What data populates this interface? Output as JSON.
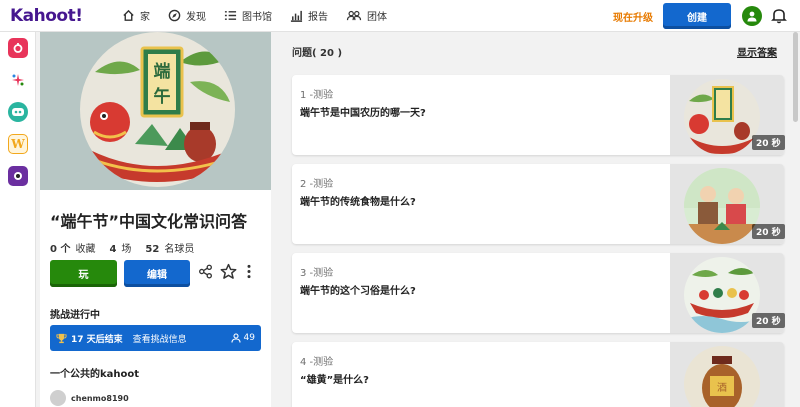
{
  "nav": {
    "logo": "Kahoot!",
    "items": [
      {
        "label": "家",
        "icon": "home-icon"
      },
      {
        "label": "发现",
        "icon": "compass-icon"
      },
      {
        "label": "图书馆",
        "icon": "list-icon"
      },
      {
        "label": "报告",
        "icon": "bar-chart-icon"
      },
      {
        "label": "团体",
        "icon": "group-icon"
      }
    ],
    "upgrade": "现在升级",
    "create": "创建"
  },
  "rail": {
    "apps": [
      {
        "name": "app-icon-1",
        "color": "#e8345a",
        "glyph": "o"
      },
      {
        "name": "app-icon-2",
        "color": "#ffffff",
        "glyph": "✦"
      },
      {
        "name": "app-icon-3",
        "color": "#2ab5a0",
        "glyph": "◉"
      },
      {
        "name": "app-icon-4",
        "color": "#f2a81d",
        "glyph": "W"
      },
      {
        "name": "app-icon-5",
        "color": "#6b2fa0",
        "glyph": "●"
      }
    ]
  },
  "kahoot": {
    "title": "“端午节”中国文化常识问答",
    "cover_text": "端午",
    "favorites_count": "0 个",
    "favorites_label": "收藏",
    "plays_count": "4",
    "plays_label": "场",
    "players_count": "52",
    "players_label": "名球员",
    "play_button": "玩",
    "edit_button": "编辑",
    "challenge_heading": "挑战进行中",
    "challenge_days": "17 天后结束",
    "challenge_link": "查看挑战信息",
    "challenge_players": "49",
    "public_heading": "一个公共的kahoot",
    "creator": "chenmo8190"
  },
  "questions": {
    "header": "问题( 20 )",
    "show_answers": "显示答案",
    "items": [
      {
        "type": "1 -测验",
        "text": "端午节是中国农历的哪一天?",
        "time": "20 秒"
      },
      {
        "type": "2 -测验",
        "text": "端午节的传统食物是什么?",
        "time": "20 秒"
      },
      {
        "type": "3 -测验",
        "text": "端午节的这个习俗是什么?",
        "time": "20 秒"
      },
      {
        "type": "4 -测验",
        "text": "“雄黄”是什么?",
        "time": "20 秒"
      }
    ]
  },
  "colors": {
    "brand": "#46178f",
    "blue": "#1368ce",
    "green": "#26890c",
    "orange": "#e77a00"
  }
}
